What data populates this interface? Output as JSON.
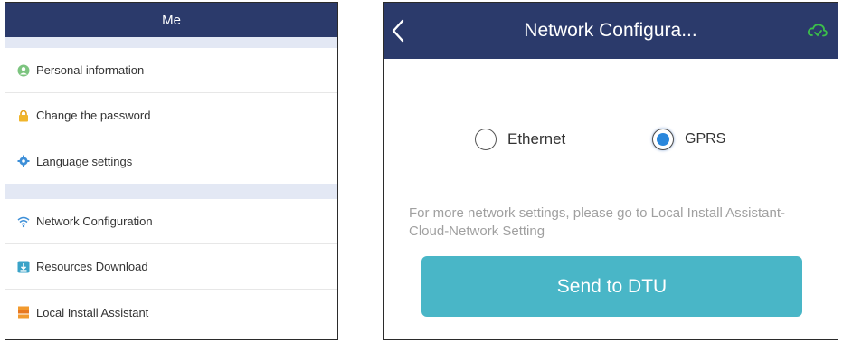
{
  "me_screen": {
    "title": "Me",
    "items": [
      {
        "label": "Personal information",
        "icon": "person-icon"
      },
      {
        "label": "Change the password",
        "icon": "lock-icon"
      },
      {
        "label": "Language settings",
        "icon": "gear-icon"
      },
      {
        "label": "Network Configuration",
        "icon": "wifi-icon"
      },
      {
        "label": "Resources Download",
        "icon": "download-icon"
      },
      {
        "label": "Local Install Assistant",
        "icon": "assistant-icon"
      }
    ]
  },
  "network_screen": {
    "title": "Network Configura...",
    "back_icon": "chevron-left-icon",
    "status_icon": "cloud-icon",
    "options": [
      {
        "label": "Ethernet",
        "selected": false
      },
      {
        "label": "GPRS",
        "selected": true
      }
    ],
    "hint": "For more network settings, please go to Local Install Assistant-Cloud-Network Setting",
    "send_button": "Send to DTU"
  },
  "colors": {
    "header": "#2b3a6b",
    "section_gap": "#e3e8f4",
    "button": "#49b6c7",
    "radio_selected": "#2a87dc",
    "status_icon": "#3bbf4a"
  }
}
